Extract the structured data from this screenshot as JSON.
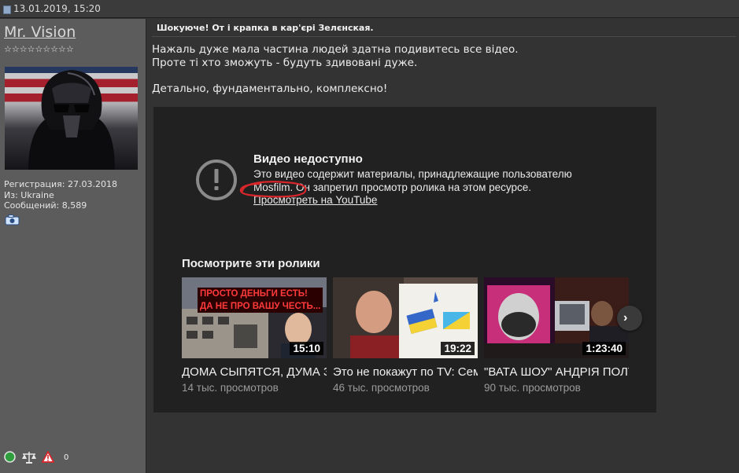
{
  "post": {
    "date": "13.01.2019, 15:20"
  },
  "user": {
    "name": "Mr. Vision",
    "stars": "☆☆☆☆☆☆☆☆☆",
    "registration": "Регистрация: 27.03.2018",
    "location": "Из: Ukraine",
    "posts": "Сообщений: 8,589",
    "bottom_count": "0"
  },
  "content": {
    "title": "Шокуюче! От і крапка в кар'єрі Зелєнская.",
    "line1": "Нажаль дуже мала частина людей здатна подивитесь все відео.",
    "line2": "Проте ті хто зможуть - будуть здивовані дуже.",
    "line3": "Детально, фундаментально, комплексно!"
  },
  "youtube": {
    "unavailable_title": "Видео недоступно",
    "message_line1": "Это видео содержит материалы, принадлежащие пользователю",
    "message_line2": "Mosfilm. Он запретил просмотр ролика на этом ресурсе.",
    "watch_link": "Просмотреть на YouTube",
    "more_title": "Посмотрите эти ролики",
    "videos": [
      {
        "title": "ДОМА СЫПЯТСЯ, ДУМА ЗАСЕДАЕТ",
        "views": "14 тыс. просмотров",
        "duration": "15:10",
        "overlay_line1": "ПРОСТО ДЕНЬГИ ЕСТЬ!",
        "overlay_line2": "ДА НЕ ПРО ВАШУ ЧЕСТЬ..."
      },
      {
        "title": "Это не покажут по TV: Семченко",
        "views": "46 тыс. просмотров",
        "duration": "19:22"
      },
      {
        "title": "\"ВАТА ШОУ\" АНДРІЯ ПОЛТАВИ",
        "views": "90 тыс. просмотров",
        "duration": "1:23:40"
      }
    ]
  },
  "colors": {
    "accent_red": "#d8262b",
    "link": "#eaeaea"
  }
}
